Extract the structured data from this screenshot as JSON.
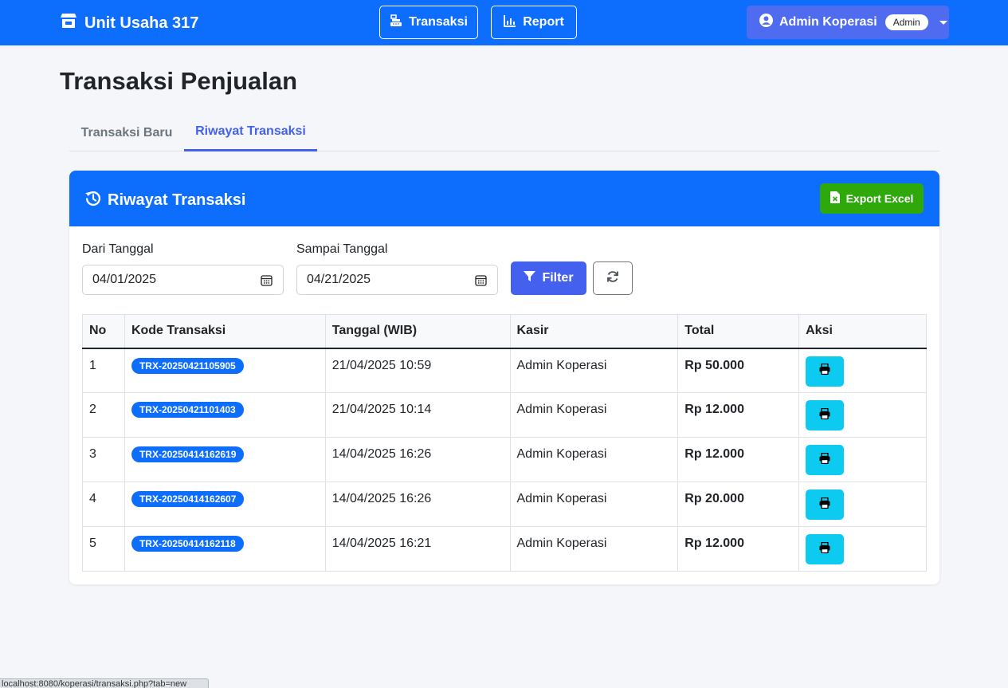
{
  "app": {
    "brand": "Unit Usaha 317"
  },
  "nav": {
    "transaksi_label": "Transaksi",
    "report_label": "Report",
    "user_name": "Admin Koperasi",
    "user_role": "Admin"
  },
  "page": {
    "title": "Transaksi Penjualan"
  },
  "tabs": [
    {
      "label": "Transaksi Baru",
      "active": false
    },
    {
      "label": "Riwayat Transaksi",
      "active": true
    }
  ],
  "card": {
    "title": "Riwayat Transaksi",
    "export_label": "Export Excel"
  },
  "filter": {
    "from_label": "Dari Tanggal",
    "from_value": "04/01/2025",
    "to_label": "Sampai Tanggal",
    "to_value": "04/21/2025",
    "filter_label": "Filter"
  },
  "table": {
    "headers": [
      "No",
      "Kode Transaksi",
      "Tanggal (WIB)",
      "Kasir",
      "Total",
      "Aksi"
    ],
    "rows": [
      {
        "no": "1",
        "code": "TRX-20250421105905",
        "date": "21/04/2025 10:59",
        "cashier": "Admin Koperasi",
        "total": "Rp 50.000"
      },
      {
        "no": "2",
        "code": "TRX-20250421101403",
        "date": "21/04/2025 10:14",
        "cashier": "Admin Koperasi",
        "total": "Rp 12.000"
      },
      {
        "no": "3",
        "code": "TRX-20250414162619",
        "date": "14/04/2025 16:26",
        "cashier": "Admin Koperasi",
        "total": "Rp 12.000"
      },
      {
        "no": "4",
        "code": "TRX-20250414162607",
        "date": "14/04/2025 16:26",
        "cashier": "Admin Koperasi",
        "total": "Rp 20.000"
      },
      {
        "no": "5",
        "code": "TRX-20250414162118",
        "date": "14/04/2025 16:21",
        "cashier": "Admin Koperasi",
        "total": "Rp 12.000"
      }
    ]
  },
  "status_bar": {
    "url": "localhost:8080/koperasi/transaksi.php?tab=new"
  },
  "colors": {
    "primary": "#0d6efd",
    "accent": "#4361ee",
    "export": "#2ea80b",
    "print": "#0dcaf0"
  },
  "icons": {
    "brand": "store-icon",
    "transaksi": "cash-register-icon",
    "report": "chart-line-icon",
    "user": "user-circle-icon",
    "card": "history-icon",
    "export": "file-excel-icon",
    "date": "calendar-icon",
    "filter": "filter-icon",
    "reset": "sync-icon",
    "print": "print-icon"
  }
}
